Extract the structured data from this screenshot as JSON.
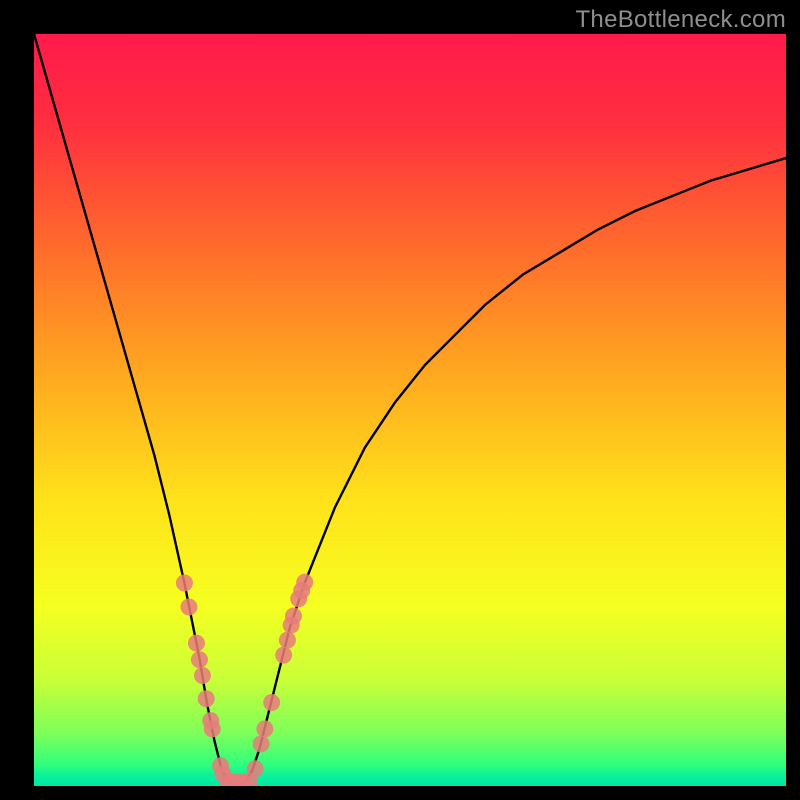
{
  "watermark": "TheBottleneck.com",
  "colors": {
    "frame": "#000000",
    "gradient_stops": [
      {
        "offset": 0.0,
        "color": "#ff1a4b"
      },
      {
        "offset": 0.12,
        "color": "#ff2f3f"
      },
      {
        "offset": 0.28,
        "color": "#ff6a2c"
      },
      {
        "offset": 0.46,
        "color": "#ffab1f"
      },
      {
        "offset": 0.62,
        "color": "#ffe21a"
      },
      {
        "offset": 0.76,
        "color": "#f6ff20"
      },
      {
        "offset": 0.86,
        "color": "#c8ff38"
      },
      {
        "offset": 0.93,
        "color": "#7dff5a"
      },
      {
        "offset": 0.972,
        "color": "#2fff7d"
      },
      {
        "offset": 0.985,
        "color": "#0cf29a"
      },
      {
        "offset": 1.0,
        "color": "#00e6a8"
      }
    ],
    "curve": "#000000",
    "marker_fill": "#e77b7b",
    "marker_stroke": "#c95858"
  },
  "chart_data": {
    "type": "line",
    "title": "",
    "xlabel": "",
    "ylabel": "",
    "xlim": [
      0,
      100
    ],
    "ylim": [
      0,
      100
    ],
    "series": [
      {
        "name": "bottleneck-curve",
        "x_optimum": 27,
        "x": [
          0,
          2,
          4,
          6,
          8,
          10,
          12,
          14,
          16,
          18,
          20,
          21,
          22,
          23,
          24,
          25,
          26,
          27,
          28,
          29,
          30,
          31,
          32,
          33,
          34,
          36,
          38,
          40,
          44,
          48,
          52,
          56,
          60,
          65,
          70,
          75,
          80,
          85,
          90,
          95,
          100
        ],
        "y": [
          100,
          93,
          86,
          79,
          72,
          65,
          58,
          51,
          44,
          36,
          27,
          22,
          17,
          11,
          6,
          2,
          0.5,
          0,
          0.5,
          2,
          5,
          9,
          13,
          17,
          21,
          27,
          32,
          37,
          45,
          51,
          56,
          60,
          64,
          68,
          71,
          74,
          76.5,
          78.5,
          80.5,
          82,
          83.5
        ]
      }
    ],
    "markers": {
      "name": "sample-gpus",
      "points": [
        {
          "x": 20.0,
          "y": 27.0
        },
        {
          "x": 20.6,
          "y": 23.8
        },
        {
          "x": 21.6,
          "y": 19.0
        },
        {
          "x": 22.0,
          "y": 16.8
        },
        {
          "x": 22.4,
          "y": 14.7
        },
        {
          "x": 22.9,
          "y": 11.6
        },
        {
          "x": 23.5,
          "y": 8.7
        },
        {
          "x": 23.7,
          "y": 7.6
        },
        {
          "x": 24.8,
          "y": 2.7
        },
        {
          "x": 25.1,
          "y": 1.6
        },
        {
          "x": 25.8,
          "y": 0.6
        },
        {
          "x": 26.5,
          "y": 0.5
        },
        {
          "x": 27.1,
          "y": 0.5
        },
        {
          "x": 27.9,
          "y": 0.5
        },
        {
          "x": 28.6,
          "y": 0.6
        },
        {
          "x": 29.4,
          "y": 2.3
        },
        {
          "x": 30.2,
          "y": 5.6
        },
        {
          "x": 30.7,
          "y": 7.6
        },
        {
          "x": 31.6,
          "y": 11.1
        },
        {
          "x": 33.2,
          "y": 17.4
        },
        {
          "x": 33.7,
          "y": 19.4
        },
        {
          "x": 34.2,
          "y": 21.4
        },
        {
          "x": 34.5,
          "y": 22.6
        },
        {
          "x": 35.2,
          "y": 24.9
        },
        {
          "x": 35.6,
          "y": 26.0
        },
        {
          "x": 36.0,
          "y": 27.1
        }
      ]
    }
  }
}
